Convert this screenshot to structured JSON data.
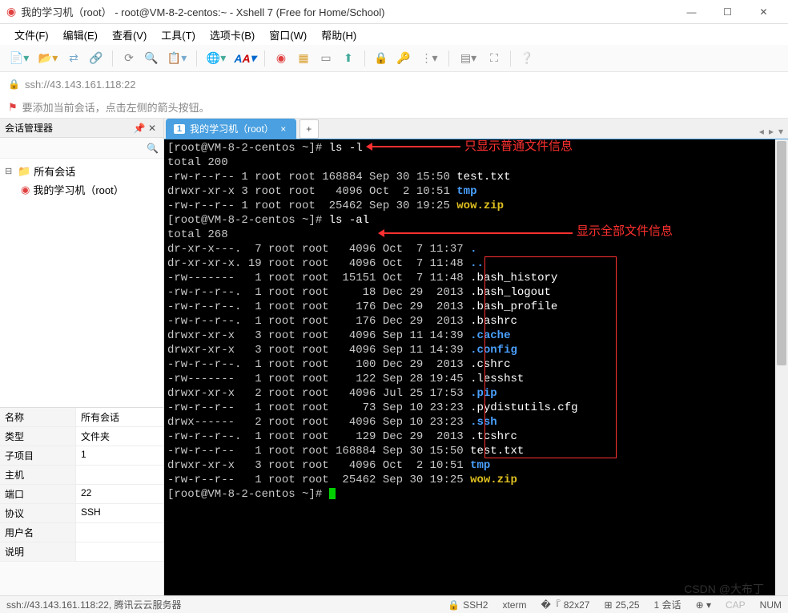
{
  "window": {
    "title": "我的学习机（root） - root@VM-8-2-centos:~ - Xshell 7 (Free for Home/School)"
  },
  "menu": [
    "文件(F)",
    "编辑(E)",
    "查看(V)",
    "工具(T)",
    "选项卡(B)",
    "窗口(W)",
    "帮助(H)"
  ],
  "address": "ssh://43.143.161.118:22",
  "hint": "要添加当前会话，点击左侧的箭头按钮。",
  "sidebar": {
    "title": "会话管理器",
    "root": "所有会话",
    "session": "我的学习机（root）"
  },
  "props": [
    {
      "k": "名称",
      "v": "所有会话"
    },
    {
      "k": "类型",
      "v": "文件夹"
    },
    {
      "k": "子项目",
      "v": "1"
    },
    {
      "k": "主机",
      "v": ""
    },
    {
      "k": "端口",
      "v": "22"
    },
    {
      "k": "协议",
      "v": "SSH"
    },
    {
      "k": "用户名",
      "v": ""
    },
    {
      "k": "说明",
      "v": ""
    }
  ],
  "tab": {
    "num": "1",
    "label": "我的学习机（root）"
  },
  "terminal": {
    "prompt": "[root@VM-8-2-centos ~]#",
    "cmd1": "ls -l",
    "tot1": "total 200",
    "ls1": [
      {
        "perm": "-rw-r--r--",
        "n": "1",
        "u": "root",
        "g": "root",
        "sz": "168884",
        "d": "Sep 30 15:50",
        "f": "test.txt",
        "c": "wf"
      },
      {
        "perm": "drwxr-xr-x",
        "n": "3",
        "u": "root",
        "g": "root",
        "sz": "4096",
        "d": "Oct  2 10:51",
        "f": "tmp",
        "c": "bl"
      },
      {
        "perm": "-rw-r--r--",
        "n": "1",
        "u": "root",
        "g": "root",
        "sz": "25462",
        "d": "Sep 30 19:25",
        "f": "wow.zip",
        "c": "ye"
      }
    ],
    "cmd2": "ls -al",
    "tot2": "total 268",
    "ls2": [
      {
        "perm": "dr-xr-x---.",
        "n": "7",
        "u": "root",
        "g": "root",
        "sz": "4096",
        "d": "Oct  7 11:37",
        "f": ".",
        "c": "bl"
      },
      {
        "perm": "dr-xr-xr-x.",
        "n": "19",
        "u": "root",
        "g": "root",
        "sz": "4096",
        "d": "Oct  7 11:48",
        "f": "..",
        "c": "bl"
      },
      {
        "perm": "-rw-------",
        "n": "1",
        "u": "root",
        "g": "root",
        "sz": "15151",
        "d": "Oct  7 11:48",
        "f": ".bash_history",
        "c": "wf"
      },
      {
        "perm": "-rw-r--r--.",
        "n": "1",
        "u": "root",
        "g": "root",
        "sz": "18",
        "d": "Dec 29  2013",
        "f": ".bash_logout",
        "c": "wf"
      },
      {
        "perm": "-rw-r--r--.",
        "n": "1",
        "u": "root",
        "g": "root",
        "sz": "176",
        "d": "Dec 29  2013",
        "f": ".bash_profile",
        "c": "wf"
      },
      {
        "perm": "-rw-r--r--.",
        "n": "1",
        "u": "root",
        "g": "root",
        "sz": "176",
        "d": "Dec 29  2013",
        "f": ".bashrc",
        "c": "wf"
      },
      {
        "perm": "drwxr-xr-x",
        "n": "3",
        "u": "root",
        "g": "root",
        "sz": "4096",
        "d": "Sep 11 14:39",
        "f": ".cache",
        "c": "bl"
      },
      {
        "perm": "drwxr-xr-x",
        "n": "3",
        "u": "root",
        "g": "root",
        "sz": "4096",
        "d": "Sep 11 14:39",
        "f": ".config",
        "c": "bl"
      },
      {
        "perm": "-rw-r--r--.",
        "n": "1",
        "u": "root",
        "g": "root",
        "sz": "100",
        "d": "Dec 29  2013",
        "f": ".cshrc",
        "c": "wf"
      },
      {
        "perm": "-rw-------",
        "n": "1",
        "u": "root",
        "g": "root",
        "sz": "122",
        "d": "Sep 28 19:45",
        "f": ".lesshst",
        "c": "wf"
      },
      {
        "perm": "drwxr-xr-x",
        "n": "2",
        "u": "root",
        "g": "root",
        "sz": "4096",
        "d": "Jul 25 17:53",
        "f": ".pip",
        "c": "bl"
      },
      {
        "perm": "-rw-r--r--",
        "n": "1",
        "u": "root",
        "g": "root",
        "sz": "73",
        "d": "Sep 10 23:23",
        "f": ".pydistutils.cfg",
        "c": "wf"
      },
      {
        "perm": "drwx------",
        "n": "2",
        "u": "root",
        "g": "root",
        "sz": "4096",
        "d": "Sep 10 23:23",
        "f": ".ssh",
        "c": "bl"
      },
      {
        "perm": "-rw-r--r--.",
        "n": "1",
        "u": "root",
        "g": "root",
        "sz": "129",
        "d": "Dec 29  2013",
        "f": ".tcshrc",
        "c": "wf"
      },
      {
        "perm": "-rw-r--r--",
        "n": "1",
        "u": "root",
        "g": "root",
        "sz": "168884",
        "d": "Sep 30 15:50",
        "f": "test.txt",
        "c": "wf"
      },
      {
        "perm": "drwxr-xr-x",
        "n": "3",
        "u": "root",
        "g": "root",
        "sz": "4096",
        "d": "Oct  2 10:51",
        "f": "tmp",
        "c": "bl"
      },
      {
        "perm": "-rw-r--r--",
        "n": "1",
        "u": "root",
        "g": "root",
        "sz": "25462",
        "d": "Sep 30 19:25",
        "f": "wow.zip",
        "c": "ye"
      }
    ]
  },
  "annot": {
    "a1": "只显示普通文件信息",
    "a2": "显示全部文件信息"
  },
  "status": {
    "left": "ssh://43.143.161.118:22, 腾讯云云服务器",
    "proto": "SSH2",
    "term": "xterm",
    "size": "82x27",
    "pos": "25,25",
    "sess": "1 会话",
    "cap": "CAP",
    "num": "NUM"
  },
  "watermark": "CSDN @大布丁"
}
